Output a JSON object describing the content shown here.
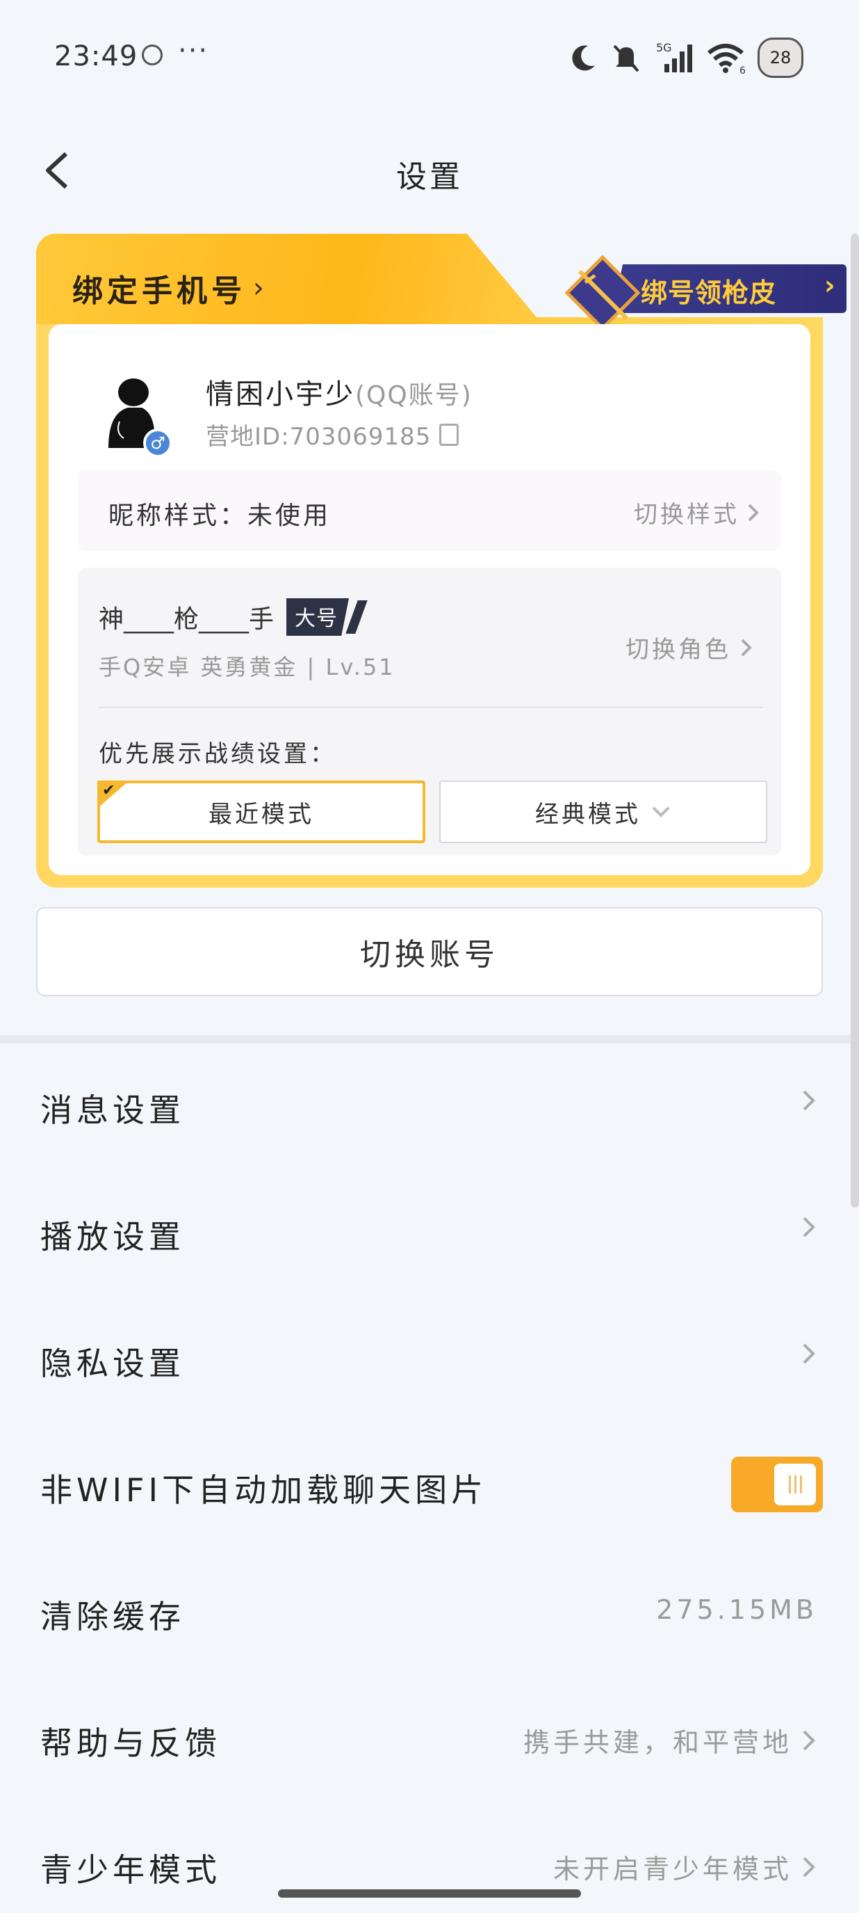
{
  "status_bar": {
    "time": "23:49",
    "dots": "···",
    "signal_label": "5G",
    "wifi_label": "6",
    "battery": "28"
  },
  "header": {
    "title": "设置"
  },
  "account_card": {
    "bind_phone": "绑定手机号",
    "promo": "绑号领枪皮",
    "user_name": "情困小宇少",
    "account_type": "(QQ账号)",
    "camp_id": "营地ID:703069185",
    "nickname_style_label": "昵称样式：",
    "nickname_style_value": "未使用",
    "switch_style": "切换样式",
    "role_name": "神____枪____手",
    "role_tag": "大号",
    "role_info": "手Q安卓  英勇黄金 |  Lv.51",
    "switch_role": "切换角色",
    "pref_label": "优先展示战绩设置：",
    "mode_recent": "最近模式",
    "mode_classic": "经典模式"
  },
  "switch_account": "切换账号",
  "settings": [
    {
      "label": "消息设置",
      "value": "",
      "chevron": true
    },
    {
      "label": "播放设置",
      "value": "",
      "chevron": true
    },
    {
      "label": "隐私设置",
      "value": "",
      "chevron": true
    },
    {
      "label": "非WIFI下自动加载聊天图片",
      "toggle": true,
      "on": true
    },
    {
      "label": "清除缓存",
      "value": "275.15MB",
      "chevron": false
    },
    {
      "label": "帮助与反馈",
      "value": "携手共建，和平营地",
      "chevron": true
    },
    {
      "label": "青少年模式",
      "value": "未开启青少年模式",
      "chevron": true
    }
  ],
  "colors": {
    "accent": "#f7a928",
    "card_yellow": "#ffd761",
    "promo_bg": "#2e2d7a",
    "promo_text": "#ffcc3a"
  }
}
